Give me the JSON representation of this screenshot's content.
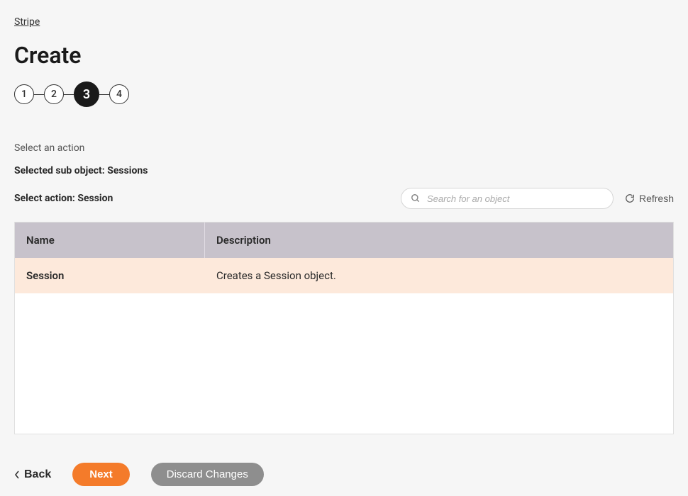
{
  "breadcrumb": "Stripe",
  "page_title": "Create",
  "stepper": {
    "steps": [
      "1",
      "2",
      "3",
      "4"
    ],
    "active_index": 2
  },
  "section_label": "Select an action",
  "sub_object_line": "Selected sub object: Sessions",
  "select_action_line": "Select action: Session",
  "search": {
    "placeholder": "Search for an object"
  },
  "refresh_label": "Refresh",
  "table": {
    "columns": {
      "name": "Name",
      "description": "Description"
    },
    "rows": [
      {
        "name": "Session",
        "description": "Creates a Session object."
      }
    ]
  },
  "footer": {
    "back": "Back",
    "next": "Next",
    "discard": "Discard Changes"
  }
}
